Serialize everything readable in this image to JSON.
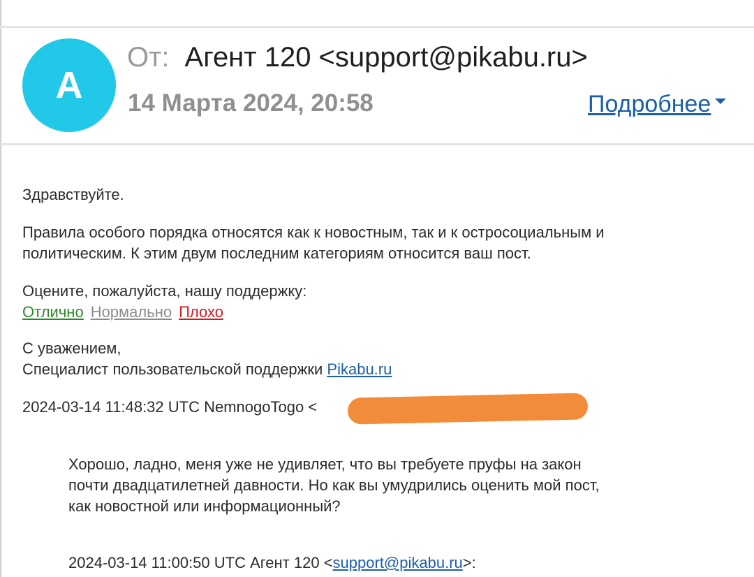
{
  "colors": {
    "avatar_bg": "#21c8e8",
    "link_blue": "#1a5fa8",
    "rate_excellent": "#2a8a2a",
    "rate_normal": "#8c8c8c",
    "rate_bad": "#d01c1c",
    "redaction": "#f28c3a"
  },
  "header": {
    "avatar_letter": "A",
    "from_label": "От:",
    "sender": "Агент 120 <support@pikabu.ru>",
    "date": "14 Марта 2024, 20:58",
    "details_label": "Подробнее"
  },
  "message": {
    "greeting": "Здравствуйте.",
    "paragraph_line1": "Правила особого порядка относятся как к новостным, так и к остросоциальным и",
    "paragraph_line2": "политическим. К этим двум последним категориям относится ваш пост.",
    "rating_prompt": "Оцените, пожалуйста, нашу поддержку:",
    "rating_options": [
      "Отлично",
      "Нормально",
      "Плохо"
    ],
    "signoff": "С уважением,",
    "signature_prefix": "Специалист пользовательской поддержки ",
    "signature_link": "Pikabu.ru",
    "reply_header": "2024-03-14 11:48:32 UTC NemnogoTogo <"
  },
  "quoted": {
    "line1": "Хорошо, ладно, меня уже не удивляет, что вы требуете пруфы на закон",
    "line2": "почти двадцатилетней давности. Но как вы умудрились оценить мой пост,",
    "line3": "как новостной или информационный?",
    "nested_header_prefix": "2024-03-14 11:00:50 UTC Агент 120 <",
    "nested_header_email": "support@pikabu.ru",
    "nested_header_suffix": ">:"
  }
}
